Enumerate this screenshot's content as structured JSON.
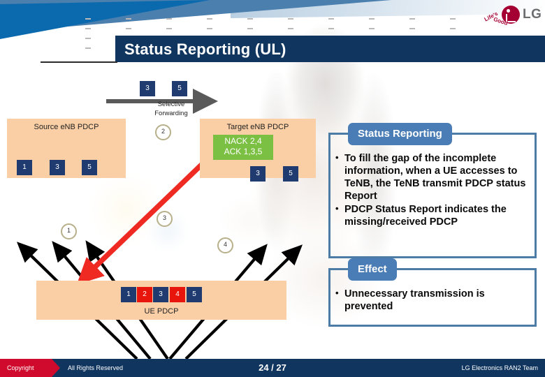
{
  "slide": {
    "title": "Status Reporting (UL)",
    "brand": {
      "name": "LG",
      "tagline_top": "Life's",
      "tagline_bottom": "Good"
    }
  },
  "diagram": {
    "source_box": {
      "label": "Source eNB PDCP",
      "packets": [
        "1",
        "3",
        "5"
      ]
    },
    "target_box": {
      "label": "Target eNB PDCP",
      "packets": [
        "3",
        "5"
      ],
      "status": {
        "nack": "NACK 2,4",
        "ack": "ACK 1,3,5"
      }
    },
    "forwarding": {
      "label_line1": "Selective",
      "label_line2": "Forwarding",
      "packets": [
        "3",
        "5"
      ]
    },
    "ue_box": {
      "label": "UE PDCP",
      "packets": [
        {
          "id": "1",
          "state": "received"
        },
        {
          "id": "2",
          "state": "missing"
        },
        {
          "id": "3",
          "state": "received"
        },
        {
          "id": "4",
          "state": "missing"
        },
        {
          "id": "5",
          "state": "received"
        }
      ]
    },
    "step_markers": [
      "1",
      "2",
      "3",
      "4"
    ]
  },
  "panels": [
    {
      "caption": "Status Reporting",
      "bullets": [
        "To fill the gap of the incomplete information, when a UE accesses to TeNB, the TeNB transmit PDCP status Report",
        "PDCP Status Report indicates the missing/received PDCP"
      ]
    },
    {
      "caption": "Effect",
      "bullets": [
        "Unnecessary transmission is prevented"
      ]
    }
  ],
  "footer": {
    "copyright": "Copyright",
    "rights": "All Rights Reserved",
    "page": "24 / 27",
    "team": "LG Electronics RAN2 Team"
  },
  "colors": {
    "title_bar": "#10355f",
    "pdcp_box": "#fbcfa6",
    "packet": "#1f3b70",
    "packet_missing": "#e8150d",
    "status_green": "#7cc043",
    "panel_blue": "#4a7db5",
    "panel_border": "#4c7ba6",
    "footer_red": "#cf0a2c",
    "brand_red": "#a50034"
  }
}
